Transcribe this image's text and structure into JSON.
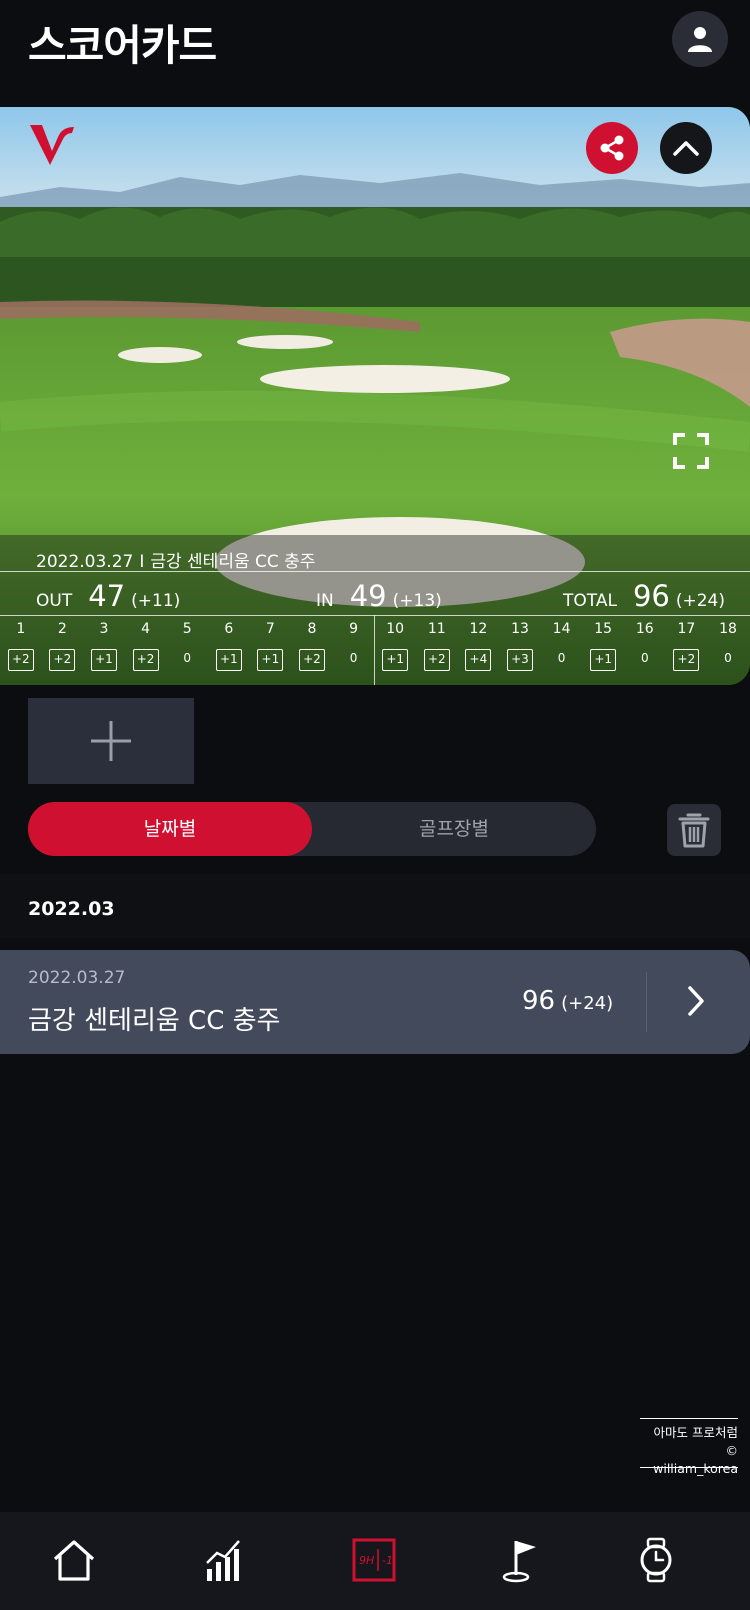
{
  "header": {
    "title": "스코어카드",
    "profile_icon": "person-icon"
  },
  "card": {
    "logo_icon": "brand-v-logo",
    "share_icon": "share-icon",
    "collapse_icon": "chevron-up-icon",
    "fullscreen_icon": "fullscreen-icon",
    "date": "2022.03.27",
    "separator": "I",
    "course": "금강 센테리움 CC 충주",
    "out": {
      "label": "OUT",
      "score": "47",
      "diff": "(+11)"
    },
    "in": {
      "label": "IN",
      "score": "49",
      "diff": "(+13)"
    },
    "total": {
      "label": "TOTAL",
      "score": "96",
      "diff": "(+24)"
    },
    "holes": [
      {
        "num": "1",
        "score": "+2"
      },
      {
        "num": "2",
        "score": "+2"
      },
      {
        "num": "3",
        "score": "+1"
      },
      {
        "num": "4",
        "score": "+2"
      },
      {
        "num": "5",
        "score": "0"
      },
      {
        "num": "6",
        "score": "+1"
      },
      {
        "num": "7",
        "score": "+1"
      },
      {
        "num": "8",
        "score": "+2"
      },
      {
        "num": "9",
        "score": "0"
      },
      {
        "num": "10",
        "score": "+1"
      },
      {
        "num": "11",
        "score": "+2"
      },
      {
        "num": "12",
        "score": "+4"
      },
      {
        "num": "13",
        "score": "+3"
      },
      {
        "num": "14",
        "score": "0"
      },
      {
        "num": "15",
        "score": "+1"
      },
      {
        "num": "16",
        "score": "0"
      },
      {
        "num": "17",
        "score": "+2"
      },
      {
        "num": "18",
        "score": "0"
      }
    ]
  },
  "add_photo_icon": "plus-icon",
  "segment": {
    "tab_date": "날짜별",
    "tab_course": "골프장별",
    "delete_icon": "trash-icon"
  },
  "list": {
    "month": "2022.03",
    "rows": [
      {
        "date": "2022.03.27",
        "course": "금강 센테리움 CC 충주",
        "score": "96",
        "diff": "(+24)"
      }
    ]
  },
  "watermark": {
    "line1": "아마도 프로처럼",
    "line2": "© william_korea"
  },
  "nav": {
    "items": [
      "home-icon",
      "stats-icon",
      "scorecard-icon",
      "course-flag-icon",
      "watch-icon"
    ]
  },
  "colors": {
    "accent": "#cf1030",
    "background": "#0c0d10",
    "row": "#434a5c"
  }
}
